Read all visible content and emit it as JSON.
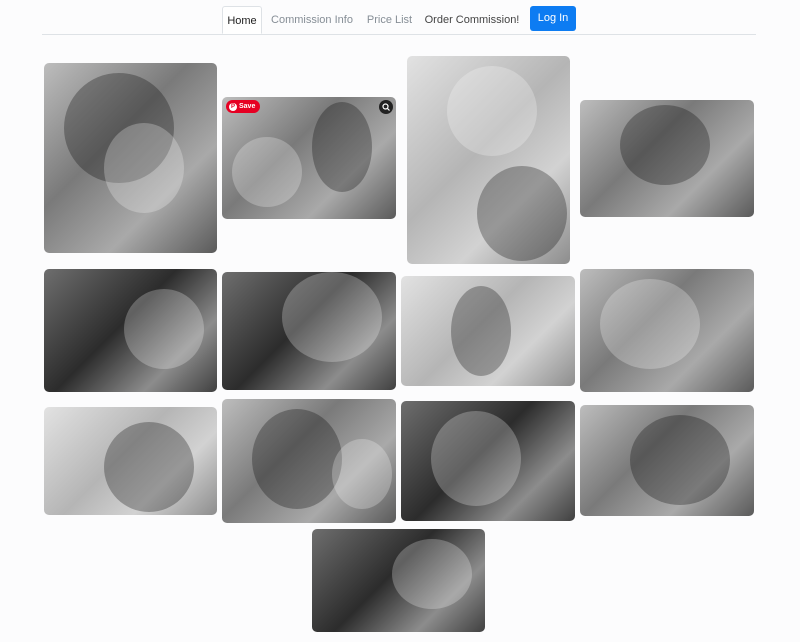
{
  "nav": {
    "tabs": [
      {
        "label": "Home",
        "active": true
      },
      {
        "label": "Commission Info",
        "active": false
      },
      {
        "label": "Price List",
        "active": false
      },
      {
        "label": "Order Commission!",
        "active": false
      }
    ],
    "login_label": "Log In"
  },
  "gallery": {
    "save_label": "Save",
    "pin_glyph": "P",
    "images": [
      {
        "name": "gallery-image-1",
        "tone": "mid"
      },
      {
        "name": "gallery-image-2",
        "tone": "mid",
        "hover": true
      },
      {
        "name": "gallery-image-3",
        "tone": "light"
      },
      {
        "name": "gallery-image-4",
        "tone": "mid"
      },
      {
        "name": "gallery-image-5",
        "tone": "dark"
      },
      {
        "name": "gallery-image-6",
        "tone": "dark"
      },
      {
        "name": "gallery-image-7",
        "tone": "light"
      },
      {
        "name": "gallery-image-8",
        "tone": "mid"
      },
      {
        "name": "gallery-image-9",
        "tone": "light"
      },
      {
        "name": "gallery-image-10",
        "tone": "mid"
      },
      {
        "name": "gallery-image-11",
        "tone": "dark"
      },
      {
        "name": "gallery-image-12",
        "tone": "mid"
      },
      {
        "name": "gallery-image-13",
        "tone": "dark"
      }
    ]
  },
  "colors": {
    "accent": "#0d7cf2",
    "pinterest_red": "#e60023",
    "nav_border": "#dee2e6"
  }
}
